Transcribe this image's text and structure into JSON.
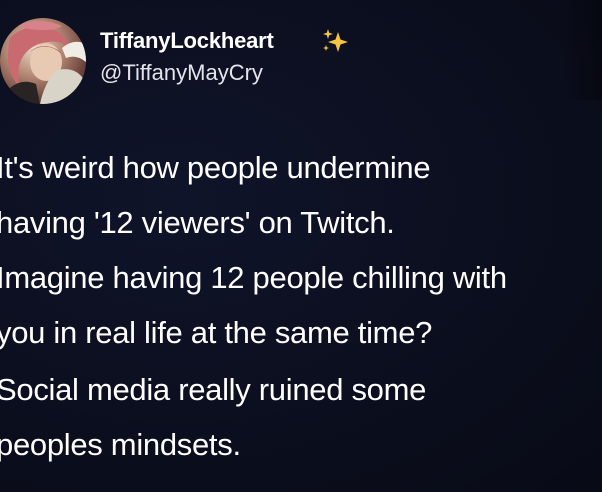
{
  "tweet": {
    "author": {
      "display_name": "TiffanyLockheart",
      "handle": "@TiffanyMayCry",
      "badge_icon": "sparkles-icon",
      "avatar": "avatar"
    },
    "paragraphs": [
      "It's weird how people undermine\nhaving '12 viewers' on Twitch.\nImagine having 12 people chilling with\nyou in real life at the same time?",
      "Social media really ruined some\npeoples mindsets."
    ]
  },
  "colors": {
    "background": "#0b0e1c",
    "text": "#ffffff",
    "sparkle": "#f5c542"
  }
}
